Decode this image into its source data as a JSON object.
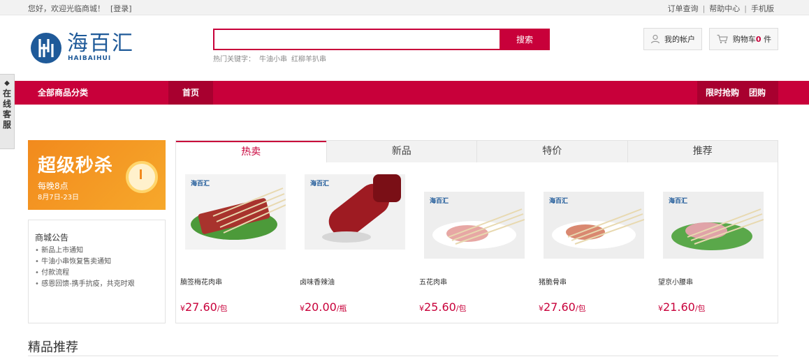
{
  "topbar": {
    "greeting": "您好，欢迎光临商城！",
    "login": "[登录]",
    "links": [
      "订单查询",
      "帮助中心",
      "手机版"
    ]
  },
  "logo": {
    "name": "海百汇",
    "name_en": "HAIBAIHUI"
  },
  "search": {
    "value": "",
    "button": "搜索",
    "hot_label": "热门关键字：",
    "hot_words": [
      "牛油小串",
      "红柳羊扒串"
    ]
  },
  "account": {
    "label": "我的帐户"
  },
  "cart": {
    "label_prefix": "购物车",
    "count": "0",
    "label_suffix": " 件"
  },
  "nav": {
    "all_categories": "全部商品分类",
    "home": "首页",
    "flash_sale": "限时抢购",
    "group_buy": "团购"
  },
  "service": {
    "label": "在线客服"
  },
  "promo": {
    "title": "超级秒杀",
    "sub1": "每晚8点",
    "sub2": "8月7日-23日"
  },
  "notice": {
    "title": "商城公告",
    "items": [
      "新品上市通知",
      "牛油小串恢复售卖通知",
      "付款流程",
      "感恩回馈-携手抗疫，共克时艰"
    ]
  },
  "tabs": [
    "热卖",
    "新品",
    "特价",
    "推荐"
  ],
  "products": [
    {
      "name": "腩签梅花肉串",
      "yen": "¥",
      "price": "27.60",
      "unit": "/包",
      "watermark": "海百汇"
    },
    {
      "name": "卤味香辣油",
      "yen": "¥",
      "price": "20.00",
      "unit": "/瓶",
      "watermark": "海百汇"
    },
    {
      "name": "五花肉串",
      "yen": "¥",
      "price": "25.60",
      "unit": "/包",
      "watermark": "海百汇"
    },
    {
      "name": "猪脆骨串",
      "yen": "¥",
      "price": "27.60",
      "unit": "/包",
      "watermark": "海百汇"
    },
    {
      "name": "望京小腰串",
      "yen": "¥",
      "price": "21.60",
      "unit": "/包",
      "watermark": "海百汇"
    }
  ],
  "recommend": {
    "title": "精品推荐"
  }
}
